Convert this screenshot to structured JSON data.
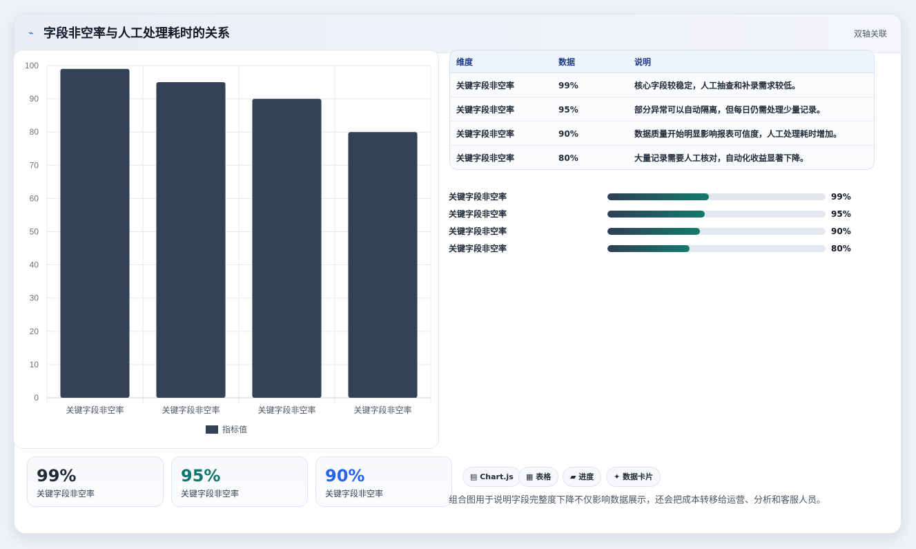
{
  "header": {
    "icon": "lightning-icon",
    "title": "字段非空率与人工处理耗时的关系",
    "badge": "双轴关联"
  },
  "chart_data": {
    "type": "bar",
    "categories": [
      "关键字段非空率",
      "关键字段非空率",
      "关键字段非空率",
      "关键字段非空率"
    ],
    "series": [
      {
        "name": "指标值",
        "values": [
          99,
          95,
          90,
          80
        ],
        "color": "#334155"
      }
    ],
    "ylim": [
      0,
      100
    ],
    "yticks": [
      0,
      10,
      20,
      30,
      40,
      50,
      60,
      70,
      80,
      90,
      100
    ],
    "grid": true,
    "legend": "bottom"
  },
  "stats": [
    {
      "value": "99%",
      "label": "关键字段非空率",
      "color": "#1f2937"
    },
    {
      "value": "95%",
      "label": "关键字段非空率",
      "color": "#0f766e"
    },
    {
      "value": "90%",
      "label": "关键字段非空率",
      "color": "#2563eb"
    }
  ],
  "table": {
    "headers": [
      "维度",
      "数据",
      "说明"
    ],
    "rows": [
      [
        "关键字段非空率",
        "99%",
        "核心字段较稳定，人工抽查和补录需求较低。"
      ],
      [
        "关键字段非空率",
        "95%",
        "部分异常可以自动隔离，但每日仍需处理少量记录。"
      ],
      [
        "关键字段非空率",
        "90%",
        "数据质量开始明显影响报表可信度，人工处理耗时增加。"
      ],
      [
        "关键字段非空率",
        "80%",
        "大量记录需要人工核对，自动化收益显著下降。"
      ]
    ]
  },
  "progress": [
    {
      "label": "关键字段非空率",
      "value_text": "99%",
      "fraction": 0.465
    },
    {
      "label": "关键字段非空率",
      "value_text": "95%",
      "fraction": 0.446
    },
    {
      "label": "关键字段非空率",
      "value_text": "90%",
      "fraction": 0.423
    },
    {
      "label": "关键字段非空率",
      "value_text": "80%",
      "fraction": 0.376
    }
  ],
  "chips": [
    {
      "icon": "chart-icon",
      "label": "Chart.js"
    },
    {
      "icon": "table-icon",
      "label": "表格"
    },
    {
      "icon": "progress-icon",
      "label": "进度"
    },
    {
      "icon": "sparkle-icon",
      "label": "数据卡片"
    }
  ],
  "note": "组合图用于说明字段完整度下降不仅影响数据展示，还会把成本转移给运营、分析和客服人员。"
}
